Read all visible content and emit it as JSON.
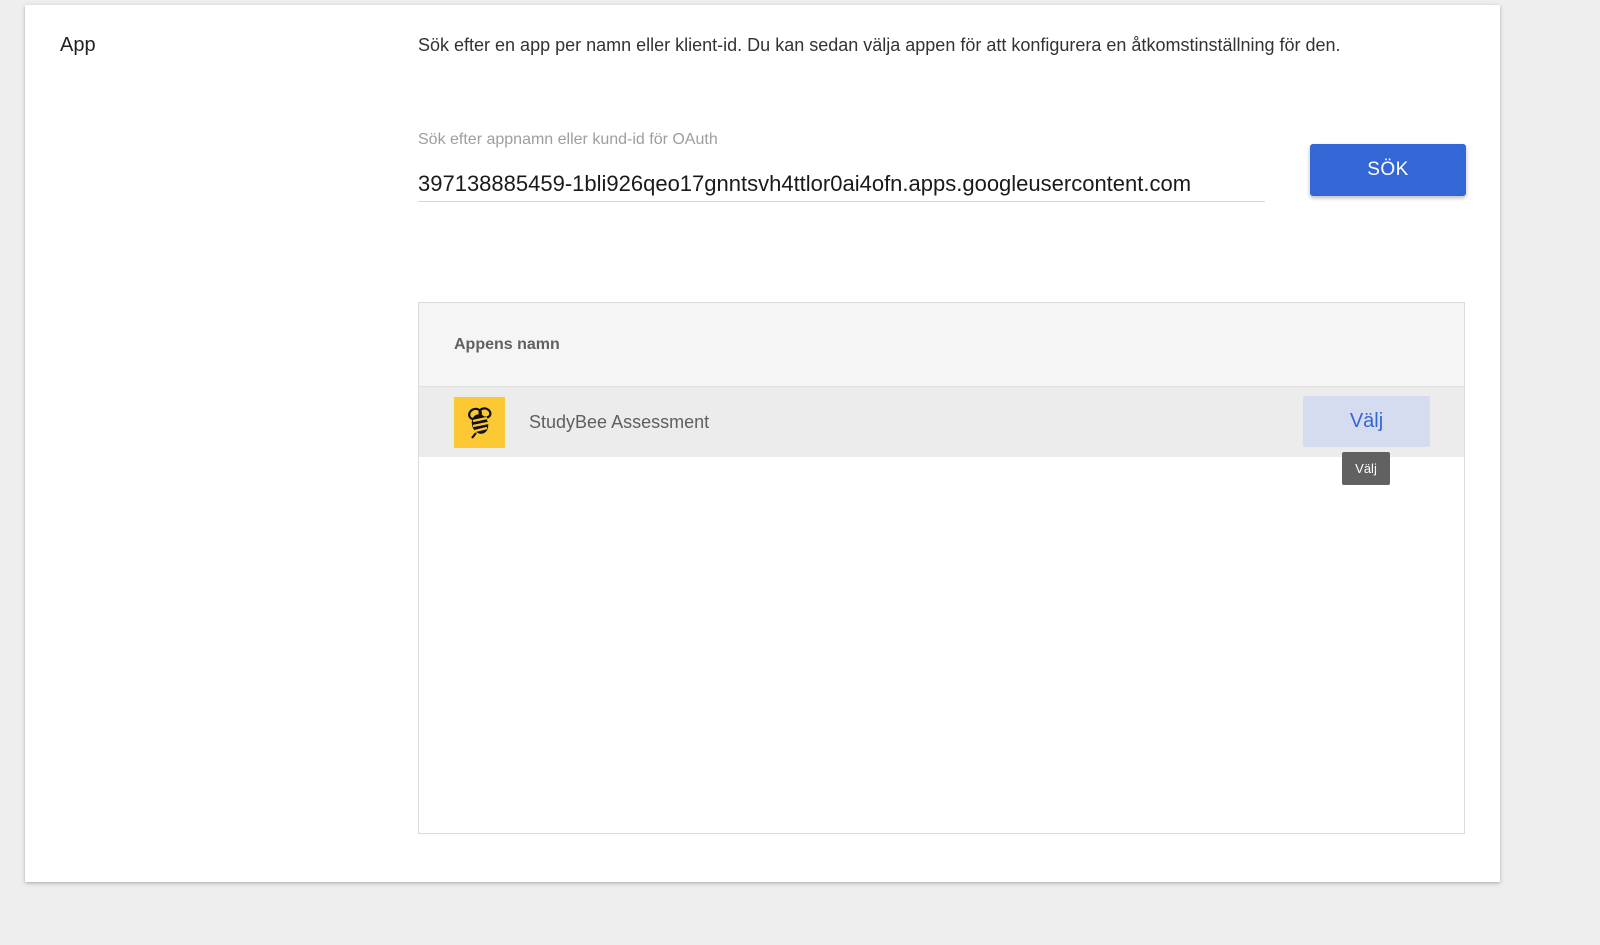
{
  "section": {
    "title": "App"
  },
  "description": "Sök efter en app per namn eller klient-id. Du kan sedan välja appen för att konfigurera en åtkomstinställning för den.",
  "search": {
    "label": "Sök efter appnamn eller kund-id för OAuth",
    "value": "397138885459-1bli926qeo17gnntsvh4ttlor0ai4ofn.apps.googleusercontent.com",
    "button_label": "SÖK"
  },
  "table": {
    "column_header": "Appens namn",
    "rows": [
      {
        "icon": "bee-icon",
        "name": "StudyBee Assessment",
        "action_label": "Välj"
      }
    ]
  },
  "tooltip": "Välj",
  "colors": {
    "primary": "#3367d6",
    "app_icon_bg": "#fcc934",
    "page_bg": "#eeeeee",
    "row_hover": "#ececec"
  }
}
